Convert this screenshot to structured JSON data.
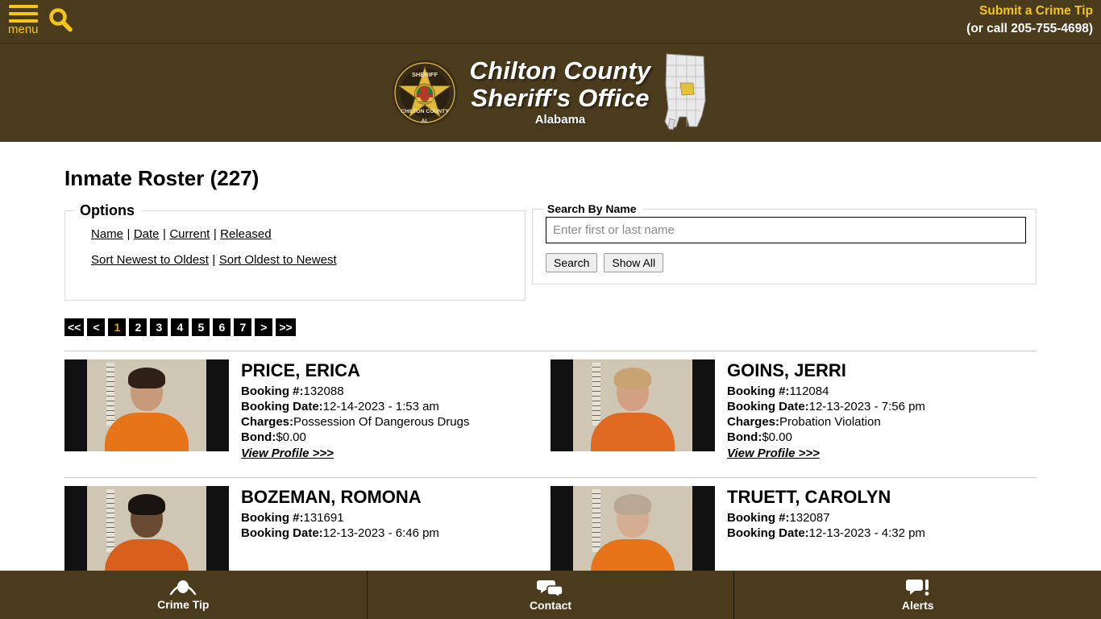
{
  "topbar": {
    "menu_label": "menu",
    "search_icon": "search-icon",
    "crime_tip_label": "Submit a Crime Tip",
    "crime_tip_phone": "(or call 205-755-4698)"
  },
  "banner": {
    "badge_icon": "sheriff-badge-icon",
    "badge_text_top": "SHERIFF",
    "badge_text_bottom": "CHILTON COUNTY",
    "badge_text_state": "AL",
    "title_line1": "Chilton County",
    "title_line2": "Sheriff's Office",
    "subtitle": "Alabama",
    "map_icon": "alabama-map-icon"
  },
  "page": {
    "title": "Inmate Roster (227)"
  },
  "options": {
    "legend": "Options",
    "filters": [
      "Name",
      "Date",
      "Current",
      "Released"
    ],
    "sorts": [
      "Sort Newest to Oldest",
      "Sort Oldest to Newest"
    ],
    "separator": "|"
  },
  "search": {
    "legend": "Search By Name",
    "placeholder": "Enter first or last name",
    "value": "",
    "search_button": "Search",
    "show_all_button": "Show All"
  },
  "pagination": {
    "first": "<<",
    "prev": "<",
    "pages": [
      "1",
      "2",
      "3",
      "4",
      "5",
      "6",
      "7"
    ],
    "active_page": "1",
    "next": ">",
    "last": ">>",
    "active_color": "#d9a521"
  },
  "labels": {
    "booking_no": "Booking #:",
    "booking_date": "Booking Date:",
    "charges": "Charges:",
    "bond": "Bond:",
    "view_profile": "View Profile >>>"
  },
  "roster": [
    {
      "name": "PRICE, ERICA",
      "booking_no": "132088",
      "booking_date": "12-14-2023 - 1:53 am",
      "charges": "Possession Of Dangerous Drugs",
      "bond": "$0.00",
      "photo": "mugshot-price-erica",
      "hair": "#2e2118",
      "skin": "#c79a7a"
    },
    {
      "name": "GOINS, JERRI",
      "booking_no": "112084",
      "booking_date": "12-13-2023 - 7:56 pm",
      "charges": "Probation Violation",
      "bond": "$0.00",
      "photo": "mugshot-goins-jerri",
      "hair": "#c9a472",
      "skin": "#d2a183"
    },
    {
      "name": "BOZEMAN, ROMONA",
      "booking_no": "131691",
      "booking_date": "12-13-2023 - 6:46 pm",
      "charges": "",
      "bond": "",
      "photo": "mugshot-bozeman-romona",
      "hair": "#1a1410",
      "skin": "#6b4a34"
    },
    {
      "name": "TRUETT, CAROLYN",
      "booking_no": "132087",
      "booking_date": "12-13-2023 - 4:32 pm",
      "charges": "",
      "bond": "",
      "photo": "mugshot-truett-carolyn",
      "hair": "#b9a893",
      "skin": "#d5ad92"
    }
  ],
  "bottomnav": [
    {
      "label": "Crime Tip",
      "icon": "eye-icon"
    },
    {
      "label": "Contact",
      "icon": "chat-bubbles-icon"
    },
    {
      "label": "Alerts",
      "icon": "alert-bubble-icon"
    }
  ],
  "colors": {
    "brand_brown": "#4a3b1d",
    "accent_gold": "#f5c518"
  }
}
